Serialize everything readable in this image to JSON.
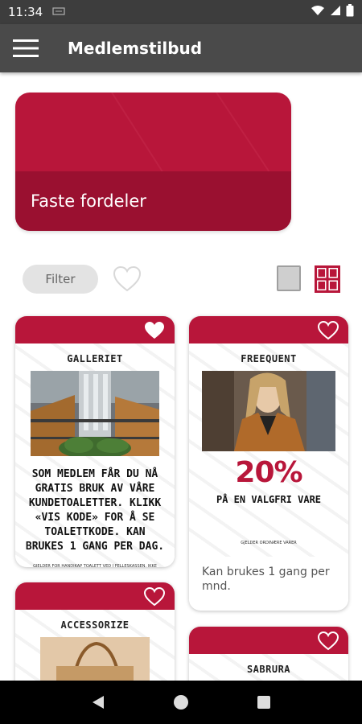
{
  "status": {
    "time": "11:34",
    "notification_icon": "sim-card-icon",
    "icons": [
      "wifi-icon",
      "signal-icon",
      "battery-icon"
    ]
  },
  "app_bar": {
    "title": "Medlemstilbud",
    "menu_icon": "hamburger-menu-icon"
  },
  "hero": {
    "label": "Faste fordeler",
    "color": "#b8163a"
  },
  "toolbar": {
    "filter_label": "Filter",
    "favorite_icon": "heart-outline-icon",
    "list_view_icon": "single-column-view-icon",
    "grid_view_icon": "grid-view-icon"
  },
  "cards": [
    {
      "brand": "GALLERIET",
      "description": "SOM MEDLEM FÅR DU NÅ GRATIS BRUK AV VÅRE KUNDETOALETTER. KLIKK «VIS KODE» FOR Å SE TOALETTKODE. KAN BRUKES 1 GANG PER DAG.",
      "fine_print": "Gjelder for handikap toalett ved i felleskassen, ikke dame/herre toaletter"
    },
    {
      "brand": "FREEQUENT",
      "discount": "20%",
      "discount_label": "PÅ EN VALGFRI VARE",
      "fine_print": "Gjelder ordinære varer",
      "footer": "Kan brukes 1 gang per mnd."
    },
    {
      "brand": "ACCESSORIZE"
    },
    {
      "brand": "SABRURA"
    }
  ],
  "nav": {
    "back_icon": "back-triangle-icon",
    "home_icon": "home-circle-icon",
    "recents_icon": "recents-square-icon"
  },
  "colors": {
    "accent": "#b8163a",
    "accent_dark": "#9a1030",
    "app_bar": "#4a4a4a"
  }
}
